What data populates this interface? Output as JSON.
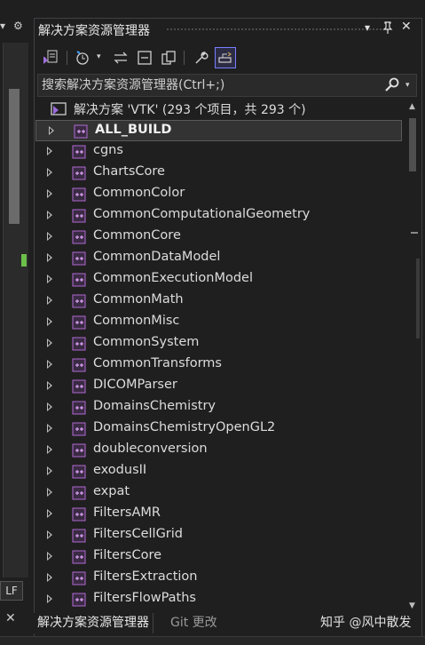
{
  "left_strip": {
    "line_ending": "LF",
    "close_glyph": "✕",
    "dropdown_glyph": "▾",
    "gear_glyph": "⚙",
    "pin_glyph": "⇔"
  },
  "panel": {
    "title": "解决方案资源管理器",
    "title_buttons": {
      "dropdown": "▾",
      "pin": "📌",
      "close": "✕"
    },
    "toolbar_icons": [
      "visual-studio-switch-icon",
      "history-clock-icon",
      "sync-arrows-icon",
      "collapse-all-icon",
      "show-all-files-icon",
      "properties-wrench-icon",
      "preview-selected-icon"
    ],
    "search": {
      "placeholder": "搜索解决方案资源管理器(Ctrl+;)",
      "value": ""
    },
    "solution_label": "解决方案 'VTK' (293 个项目，共 293 个)",
    "projects": [
      "ALL_BUILD",
      "cgns",
      "ChartsCore",
      "CommonColor",
      "CommonComputationalGeometry",
      "CommonCore",
      "CommonDataModel",
      "CommonExecutionModel",
      "CommonMath",
      "CommonMisc",
      "CommonSystem",
      "CommonTransforms",
      "DICOMParser",
      "DomainsChemistry",
      "DomainsChemistryOpenGL2",
      "doubleconversion",
      "exodusII",
      "expat",
      "FiltersAMR",
      "FiltersCellGrid",
      "FiltersCore",
      "FiltersExtraction",
      "FiltersFlowPaths"
    ],
    "selected_project": "ALL_BUILD"
  },
  "bottom_tabs": {
    "active": "解决方案资源管理器",
    "other": "Git 更改",
    "watermark": "知乎 @风中散发"
  },
  "colors": {
    "background": "#1f1f1f",
    "selected_row": "#333333",
    "accent_active": "#7a7dff",
    "project_icon": "#b06ad0",
    "status_mark": "#6cc04a"
  }
}
